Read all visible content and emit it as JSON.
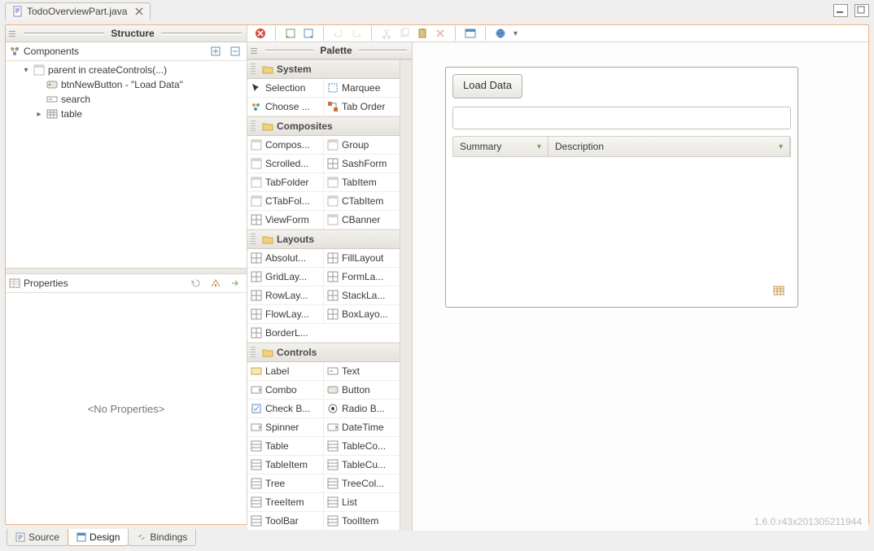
{
  "titlebar": {
    "file_name": "TodoOverviewPart.java"
  },
  "structure": {
    "header": "Structure",
    "components_label": "Components",
    "root": "parent in createControls(...)",
    "items": [
      {
        "label": "btnNewButton - \"Load Data\""
      },
      {
        "label": "search"
      },
      {
        "label": "table"
      }
    ]
  },
  "properties": {
    "header": "Properties",
    "placeholder": "<No Properties>"
  },
  "palette": {
    "header": "Palette",
    "categories": [
      {
        "name": "System",
        "items": [
          "Selection",
          "Marquee",
          "Choose ...",
          "Tab Order"
        ]
      },
      {
        "name": "Composites",
        "items": [
          "Compos...",
          "Group",
          "Scrolled...",
          "SashForm",
          "TabFolder",
          "TabItem",
          "CTabFol...",
          "CTabItem",
          "ViewForm",
          "CBanner"
        ]
      },
      {
        "name": "Layouts",
        "items": [
          "Absolut...",
          "FillLayout",
          "GridLay...",
          "FormLa...",
          "RowLay...",
          "StackLa...",
          "FlowLay...",
          "BoxLayo..."
        ],
        "extra": "BorderL..."
      },
      {
        "name": "Controls",
        "items": [
          "Label",
          "Text",
          "Combo",
          "Button",
          "Check B...",
          "Radio B...",
          "Spinner",
          "DateTime",
          "Table",
          "TableCo...",
          "TableItem",
          "TableCu...",
          "Tree",
          "TreeCol...",
          "TreeItem",
          "List",
          "ToolBar",
          "ToolItem"
        ]
      }
    ]
  },
  "design": {
    "button_label": "Load Data",
    "columns": [
      "Summary",
      "Description"
    ]
  },
  "footer": {
    "version": "1.6.0.r43x201305211944",
    "tabs": [
      "Source",
      "Design",
      "Bindings"
    ],
    "active_tab": "Design"
  }
}
